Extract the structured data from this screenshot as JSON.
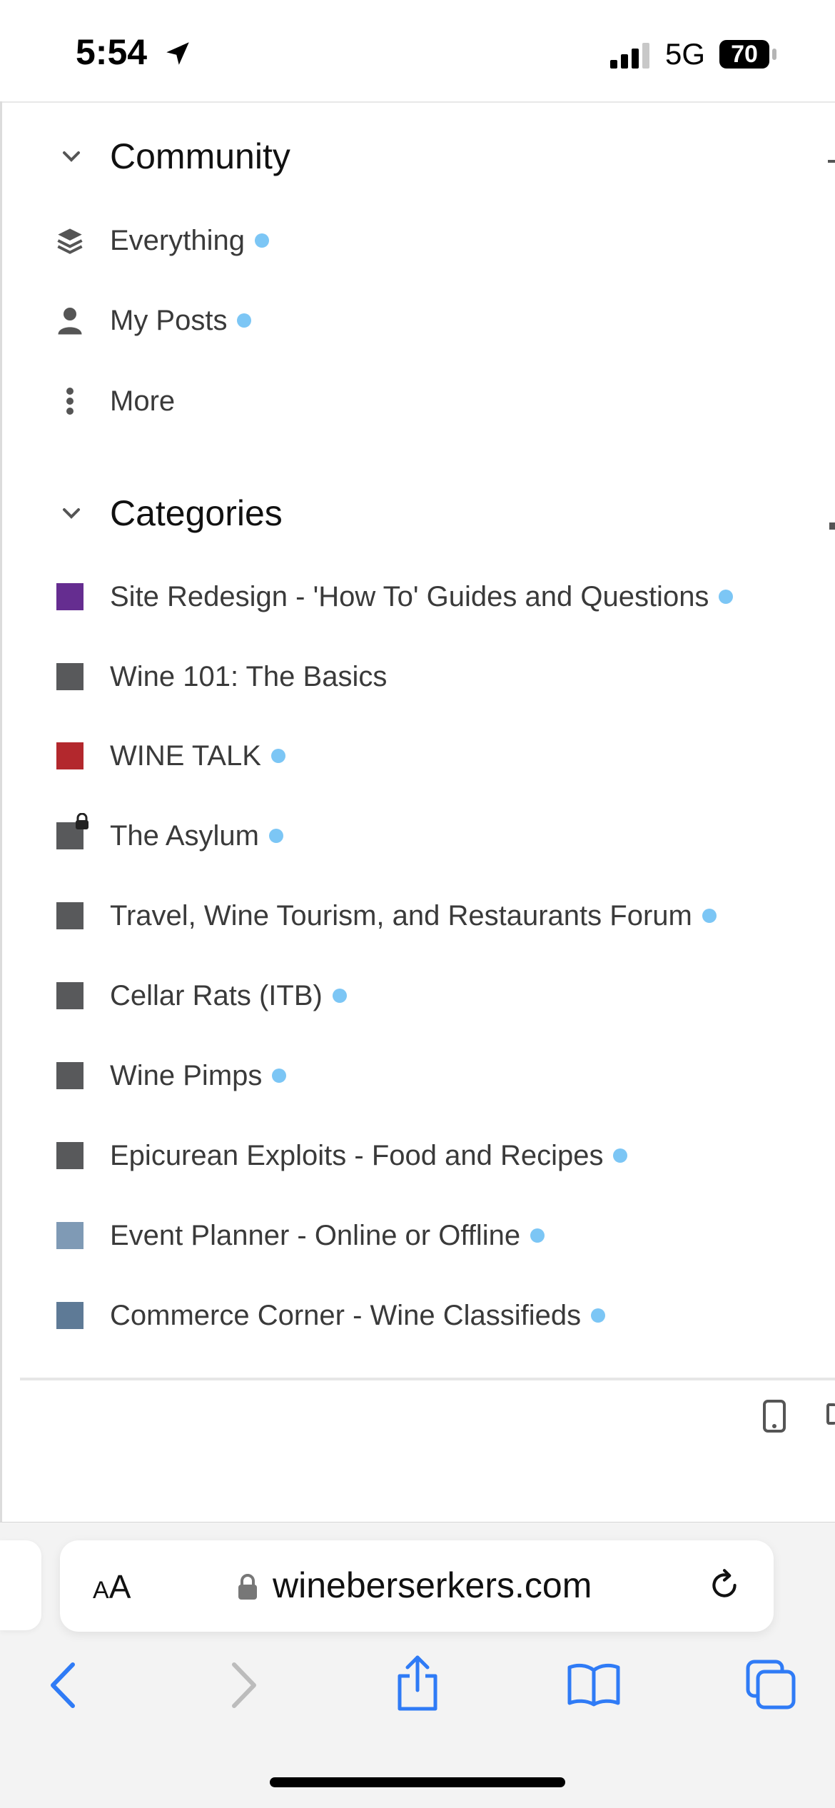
{
  "status_bar": {
    "time": "5:54",
    "network": "5G",
    "battery": "70"
  },
  "community": {
    "title": "Community",
    "items": [
      {
        "label": "Everything",
        "icon": "stack-icon",
        "unread": true
      },
      {
        "label": "My Posts",
        "icon": "user-icon",
        "unread": true
      },
      {
        "label": "More",
        "icon": "vertical-dots-icon",
        "unread": false
      }
    ]
  },
  "categories": {
    "title": "Categories",
    "items": [
      {
        "label": "Site Redesign - 'How To' Guides and Questions",
        "color": "#652d90",
        "unread": true,
        "locked": false
      },
      {
        "label": "Wine 101: The Basics",
        "color": "#58595b",
        "unread": false,
        "locked": false
      },
      {
        "label": "WINE TALK",
        "color": "#b3282d",
        "unread": true,
        "locked": false
      },
      {
        "label": "The Asylum",
        "color": "#58595b",
        "unread": true,
        "locked": true
      },
      {
        "label": "Travel, Wine Tourism, and Restaurants Forum",
        "color": "#58595b",
        "unread": true,
        "locked": false
      },
      {
        "label": "Cellar Rats (ITB)",
        "color": "#58595b",
        "unread": true,
        "locked": false
      },
      {
        "label": "Wine Pimps",
        "color": "#58595b",
        "unread": true,
        "locked": false
      },
      {
        "label": "Epicurean Exploits - Food and Recipes",
        "color": "#58595b",
        "unread": true,
        "locked": false
      },
      {
        "label": "Event Planner - Online or Offline",
        "color": "#7f9ab5",
        "unread": true,
        "locked": false
      },
      {
        "label": "Commerce Corner - Wine Classifieds",
        "color": "#5e7a96",
        "unread": true,
        "locked": false
      }
    ]
  },
  "browser": {
    "aa_label": "AA",
    "url": "wineberserkers.com"
  },
  "colors": {
    "unread_dot": "#7cc6f5",
    "safari_blue": "#2f7bf6"
  }
}
